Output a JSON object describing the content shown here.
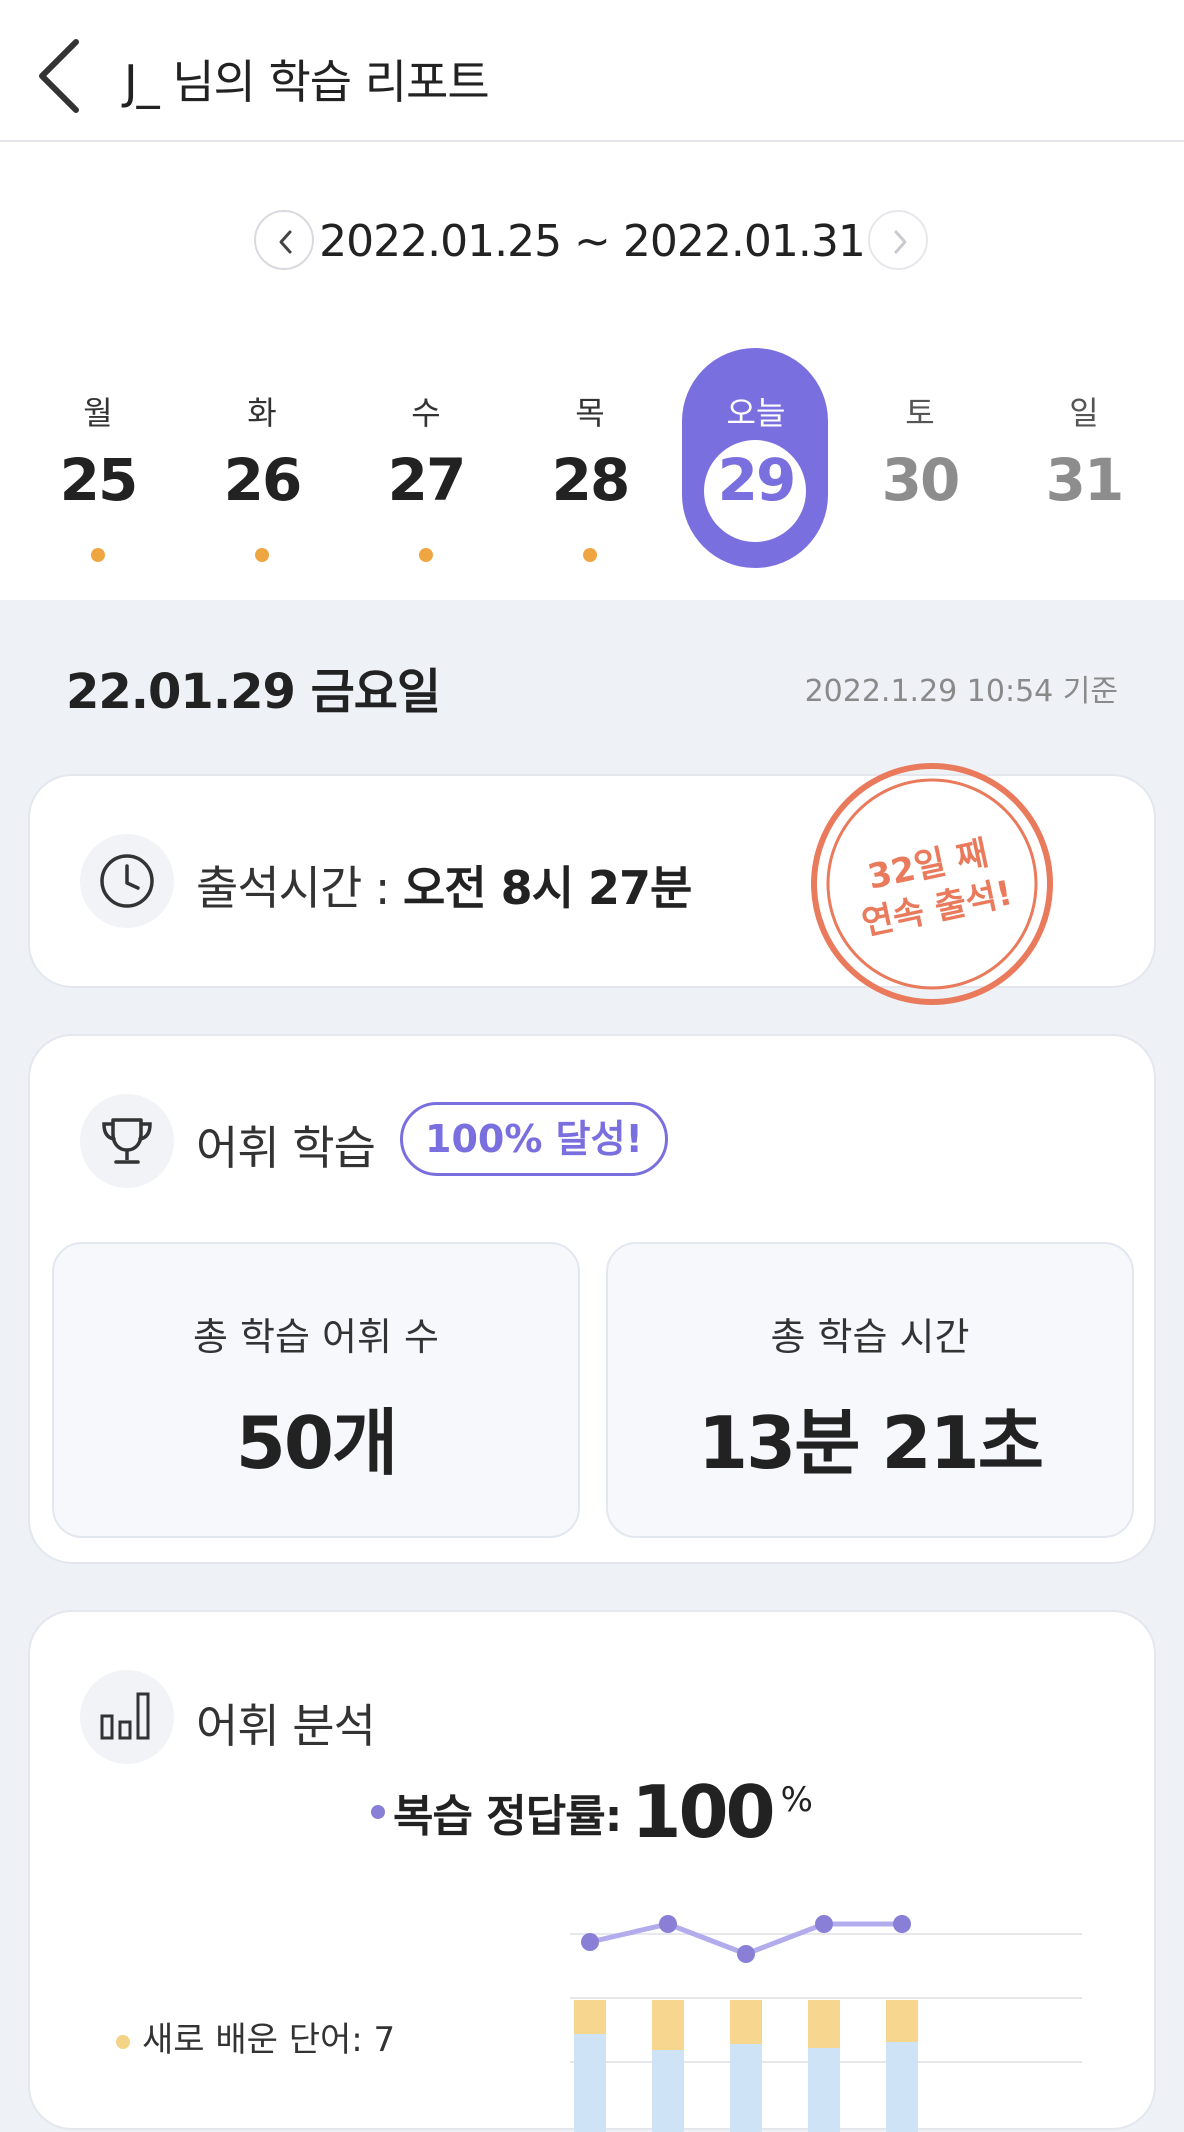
{
  "header": {
    "title": "J_ 님의 학습 리포트"
  },
  "week": {
    "range": "2022.01.25 ~ 2022.01.31",
    "days": [
      {
        "name": "월",
        "num": "25"
      },
      {
        "name": "화",
        "num": "26"
      },
      {
        "name": "수",
        "num": "27"
      },
      {
        "name": "목",
        "num": "28"
      },
      {
        "name": "오늘",
        "num": "29"
      },
      {
        "name": "토",
        "num": "30"
      },
      {
        "name": "일",
        "num": "31"
      }
    ]
  },
  "report": {
    "date": "22.01.29 금요일",
    "timestamp": "2022.1.29 10:54 기준"
  },
  "attendance": {
    "label": "출석시간 : ",
    "value": "오전 8시 27분",
    "stamp_line1": "32일 째",
    "stamp_line2": "연속 출석!"
  },
  "vocab": {
    "title": "어휘 학습",
    "badge": "100% 달성!",
    "total_words_label": "총 학습 어휘 수",
    "total_words_value": "50개",
    "total_time_label": "총 학습 시간",
    "total_time_value": "13분 21초"
  },
  "analysis": {
    "title": "어휘 분석",
    "accuracy_label": "복습 정답률:",
    "accuracy_value": "100",
    "accuracy_unit": "%",
    "legend_new": "새로 배운 단어: 7"
  },
  "colors": {
    "accent": "#7a6fdf",
    "dot": "#f0a640",
    "stamp": "#ea7a5c",
    "bar_new": "#f7d78f",
    "bar_review": "#cfe3f6",
    "line": "#b3acec",
    "line_point": "#8a7fd6"
  },
  "icons": [
    "back-icon",
    "chevron-left-icon",
    "chevron-right-icon",
    "clock-icon",
    "trophy-icon",
    "bar-chart-icon"
  ]
}
